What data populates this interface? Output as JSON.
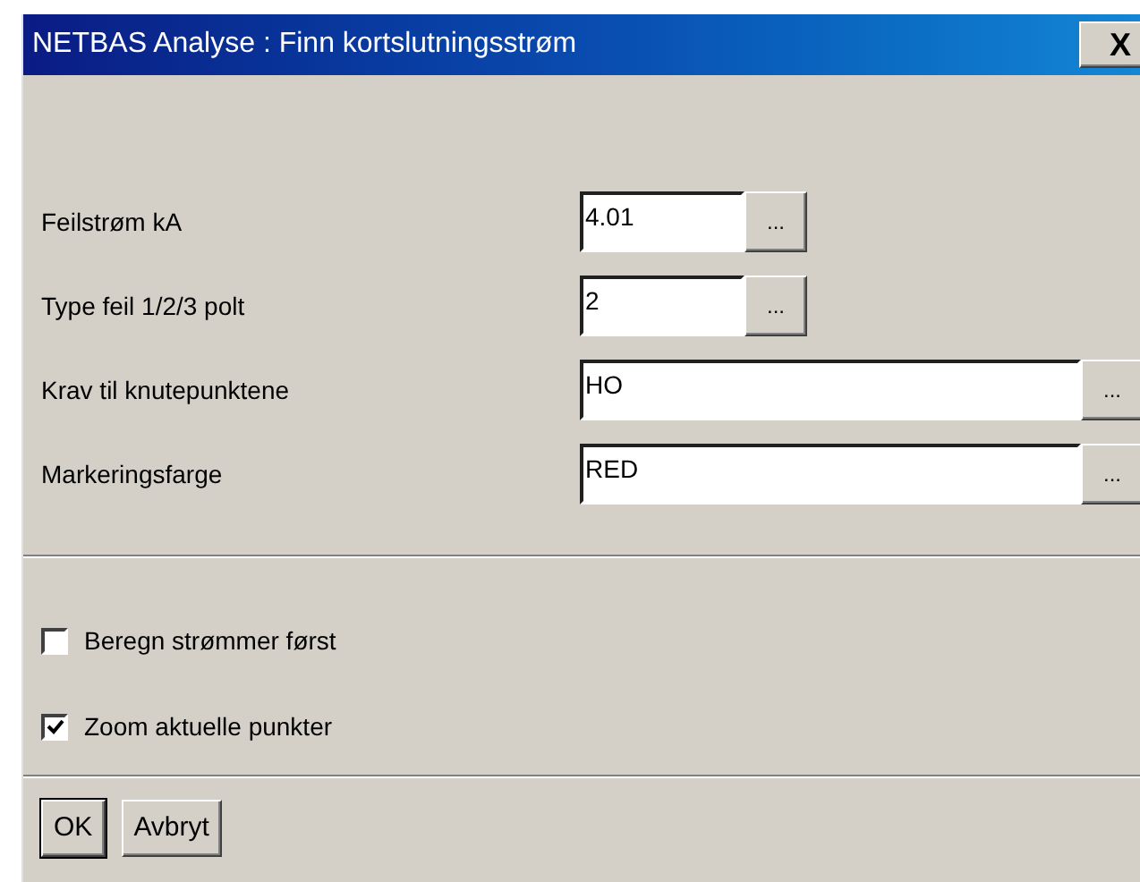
{
  "window": {
    "title": "NETBAS Analyse : Finn kortslutningsstrøm",
    "close": "X"
  },
  "fields": [
    {
      "label": "Feilstrøm  kA",
      "value": "4.01",
      "kind": "short",
      "browse": "..."
    },
    {
      "label": "Type feil 1/2/3 polt",
      "value": "2",
      "kind": "short",
      "browse": "..."
    },
    {
      "label": "Krav til knutepunktene",
      "value": "HO",
      "kind": "long",
      "browse": "..."
    },
    {
      "label": "Markeringsfarge",
      "value": "RED",
      "kind": "long",
      "browse": "..."
    }
  ],
  "checkboxes": [
    {
      "label": "Beregn strømmer først",
      "checked": false
    },
    {
      "label": "Zoom aktuelle punkter",
      "checked": true
    }
  ],
  "buttons": [
    {
      "label": "OK",
      "default": true
    },
    {
      "label": "Avbryt",
      "default": false
    }
  ]
}
